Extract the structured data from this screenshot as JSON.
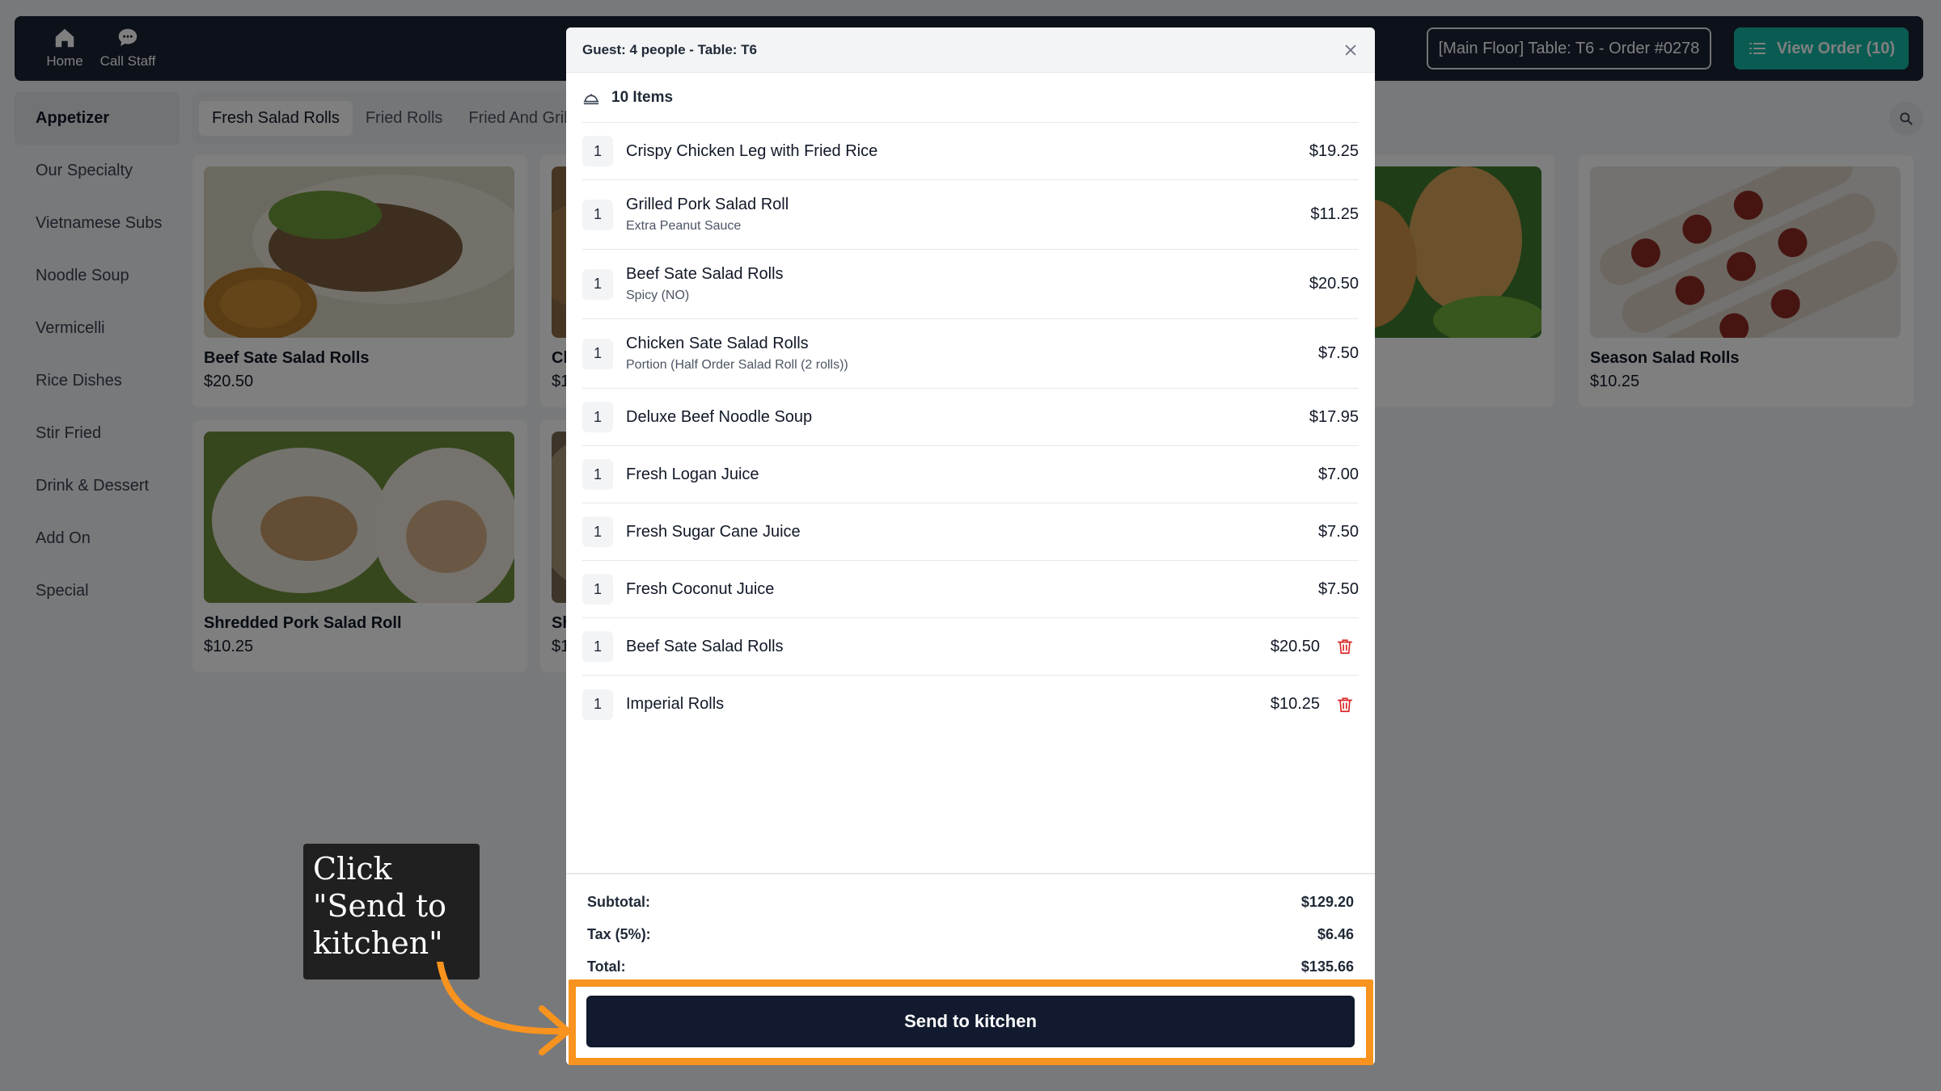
{
  "topbar": {
    "home_label": "Home",
    "call_staff_label": "Call Staff",
    "table_info": "[Main Floor] Table: T6 - Order #0278",
    "view_order_label": "View Order (10)"
  },
  "sidebar": {
    "items": [
      {
        "label": "Appetizer"
      },
      {
        "label": "Our Specialty"
      },
      {
        "label": "Vietnamese Subs"
      },
      {
        "label": "Noodle Soup"
      },
      {
        "label": "Vermicelli"
      },
      {
        "label": "Rice Dishes"
      },
      {
        "label": "Stir Fried"
      },
      {
        "label": "Drink & Dessert"
      },
      {
        "label": "Add On"
      },
      {
        "label": "Special"
      }
    ]
  },
  "subtabs": [
    "Fresh Salad Rolls",
    "Fried Rolls",
    "Fried And Grille"
  ],
  "products": [
    {
      "name": "Beef Sate Salad Rolls",
      "price": "$20.50"
    },
    {
      "name": "Ch",
      "price": "$1"
    },
    {
      "name": "",
      "price": ""
    },
    {
      "name": "Season Salad Rolls",
      "price": "$10.25"
    },
    {
      "name": "Shredded Pork Salad Roll",
      "price": "$10.25"
    },
    {
      "name": "Sh",
      "price": "$1"
    }
  ],
  "modal": {
    "header": "Guest: 4 people - Table: T6",
    "items_count": "10 Items",
    "items": [
      {
        "qty": "1",
        "name": "Crispy Chicken Leg with Fried Rice",
        "modifier": "",
        "price": "$19.25"
      },
      {
        "qty": "1",
        "name": "Grilled Pork Salad Roll",
        "modifier": "Extra Peanut Sauce",
        "price": "$11.25"
      },
      {
        "qty": "1",
        "name": "Beef Sate Salad Rolls",
        "modifier": "Spicy (NO)",
        "price": "$20.50"
      },
      {
        "qty": "1",
        "name": "Chicken Sate Salad Rolls",
        "modifier": "Portion (Half Order Salad Roll (2 rolls))",
        "price": "$7.50"
      },
      {
        "qty": "1",
        "name": "Deluxe Beef Noodle Soup",
        "modifier": "",
        "price": "$17.95"
      },
      {
        "qty": "1",
        "name": "Fresh Logan Juice",
        "modifier": "",
        "price": "$7.00"
      },
      {
        "qty": "1",
        "name": "Fresh Sugar Cane Juice",
        "modifier": "",
        "price": "$7.50"
      },
      {
        "qty": "1",
        "name": "Fresh Coconut Juice",
        "modifier": "",
        "price": "$7.50"
      },
      {
        "qty": "1",
        "name": "Beef Sate Salad Rolls",
        "modifier": "",
        "price": "$20.50"
      },
      {
        "qty": "1",
        "name": "Imperial Rolls",
        "modifier": "",
        "price": "$10.25"
      }
    ],
    "subtotal_label": "Subtotal:",
    "subtotal": "$129.20",
    "tax_label": "Tax (5%):",
    "tax": "$6.46",
    "total_label": "Total:",
    "total": "$135.66",
    "send_label": "Send to kitchen"
  },
  "annotation": {
    "callout_text": "Click \"Send to kitchen\"",
    "accent_color": "#f7931e"
  },
  "icons": [
    "home-icon",
    "chat-icon",
    "list-icon",
    "search-icon",
    "close-icon",
    "cloche-icon",
    "trash-icon"
  ]
}
